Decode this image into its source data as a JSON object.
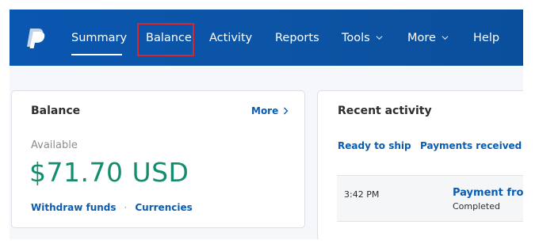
{
  "nav": {
    "items": [
      {
        "label": "Summary"
      },
      {
        "label": "Balance"
      },
      {
        "label": "Activity"
      },
      {
        "label": "Reports"
      },
      {
        "label": "Tools"
      },
      {
        "label": "More"
      },
      {
        "label": "Help"
      }
    ],
    "active": "Summary",
    "highlighted": "Balance",
    "highlight_color": "#d9262e",
    "bar_color": "#0c55a4"
  },
  "balance_card": {
    "title": "Balance",
    "more_link": "More",
    "available_label": "Available",
    "amount": "$71.70 USD",
    "amount_color": "#148c6e",
    "withdraw_link": "Withdraw funds",
    "separator": "·",
    "currencies_link": "Currencies"
  },
  "recent_activity": {
    "title": "Recent activity",
    "tabs": [
      "Ready to ship",
      "Payments received"
    ],
    "rows": [
      {
        "time": "3:42 PM",
        "name": "Payment from",
        "status": "Completed"
      }
    ]
  },
  "colors": {
    "link": "#0a5cb1",
    "text": "#2c2e2f",
    "muted": "#8a8d90"
  }
}
